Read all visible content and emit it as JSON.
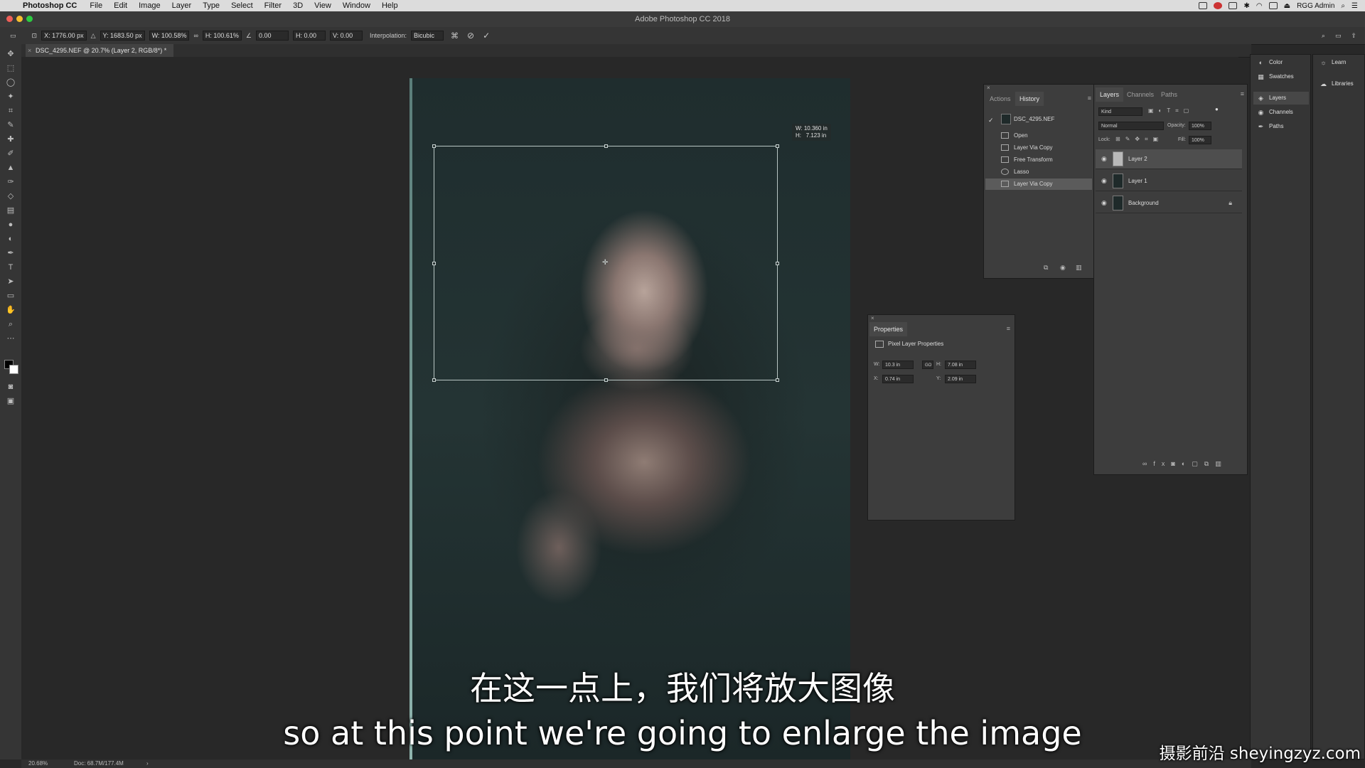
{
  "menubar": {
    "app": "Photoshop CC",
    "items": [
      "File",
      "Edit",
      "Image",
      "Layer",
      "Type",
      "Select",
      "Filter",
      "3D",
      "View",
      "Window",
      "Help"
    ],
    "user": "RGG Admin"
  },
  "window": {
    "title": "Adobe Photoshop CC 2018"
  },
  "options": {
    "x": "X: 1776.00 px",
    "y": "Y: 1683.50 px",
    "w": "W: 100.58%",
    "h": "H: 100.61%",
    "angle": "0.00",
    "hskew": "H: 0.00",
    "vskew": "V: 0.00",
    "interpolation_label": "Interpolation:",
    "interpolation_value": "Bicubic"
  },
  "document": {
    "tab": "DSC_4295.NEF @ 20.7% (Layer 2, RGB/8*) *"
  },
  "transform": {
    "readout": "W: 10.360 in\nH:   7.123 in"
  },
  "history": {
    "tabs": [
      "Actions",
      "History"
    ],
    "snapshot": "DSC_4295.NEF",
    "items": [
      "Open",
      "Layer Via Copy",
      "Free Transform",
      "Lasso",
      "Layer Via Copy"
    ]
  },
  "properties": {
    "title": "Properties",
    "section": "Pixel Layer Properties",
    "w_label": "W:",
    "w": "10.3 in",
    "h_label": "H:",
    "h": "7.08 in",
    "x_label": "X:",
    "x": "0.74 in",
    "y_label": "Y:",
    "y": "2.09 in",
    "link": "GO"
  },
  "layers": {
    "tabs": [
      "Layers",
      "Channels",
      "Paths"
    ],
    "kind": "Kind",
    "blend": "Normal",
    "opacity_label": "Opacity:",
    "opacity": "100%",
    "lock_label": "Lock:",
    "fill_label": "Fill:",
    "fill": "100%",
    "rows": [
      "Layer 2",
      "Layer 1",
      "Background"
    ]
  },
  "dock1": {
    "items": [
      "Color",
      "Swatches",
      "Layers",
      "Channels",
      "Paths"
    ]
  },
  "dock2": {
    "items": [
      "Learn",
      "Libraries"
    ]
  },
  "status": {
    "zoom": "20.68%",
    "doc": "Doc: 68.7M/177.4M"
  },
  "subtitle": {
    "cn": "在这一点上，我们将放大图像",
    "en": "so at this point we're going to enlarge the image"
  },
  "watermark": "摄影前沿 sheyingzyz.com"
}
